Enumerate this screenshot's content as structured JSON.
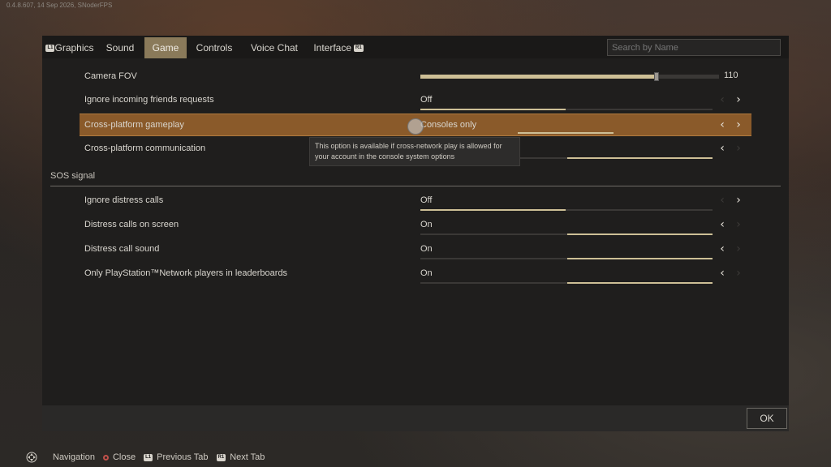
{
  "version": "0.4.8.607, 14 Sep 2026, SNoderFPS",
  "tabs": [
    {
      "label": "Graphics",
      "glyph": "L1"
    },
    {
      "label": "Sound"
    },
    {
      "label": "Game"
    },
    {
      "label": "Controls"
    },
    {
      "label": "Voice Chat"
    },
    {
      "label": "Interface",
      "glyph": "R1"
    }
  ],
  "active_tab": "Game",
  "search": {
    "placeholder": "Search by Name"
  },
  "camera_fov": {
    "label": "Camera FOV",
    "value": "110",
    "fraction": 0.79
  },
  "game_rows": [
    {
      "label": "Ignore incoming friends requests",
      "value": "Off"
    },
    {
      "label": "Cross-platform gameplay",
      "value": "Consoles only"
    },
    {
      "label": "Cross-platform communication",
      "value": ""
    }
  ],
  "tooltip": {
    "text": "This option is available if cross-network play is allowed for your account in the console system options"
  },
  "sos_section": {
    "title": "SOS signal"
  },
  "sos_rows": [
    {
      "label": "Ignore distress calls",
      "value": "Off"
    },
    {
      "label": "Distress calls on screen",
      "value": "On"
    },
    {
      "label": "Distress call sound",
      "value": "On"
    },
    {
      "label": "Only PlayStation™Network players in leaderboards",
      "value": "On"
    }
  ],
  "ok_label": "OK",
  "hints": {
    "navigation": "Navigation",
    "close": "Close",
    "prev_tab": "Previous Tab",
    "prev_glyph": "L1",
    "next_tab": "Next Tab",
    "next_glyph": "R1"
  },
  "colors": {
    "accent": "#8a5a2a",
    "tab_active": "#8a7a5a",
    "fill": "#cdbf96"
  },
  "icons": [
    "left-arrow-icon",
    "right-arrow-icon",
    "dpad-icon",
    "circle-button-icon"
  ]
}
